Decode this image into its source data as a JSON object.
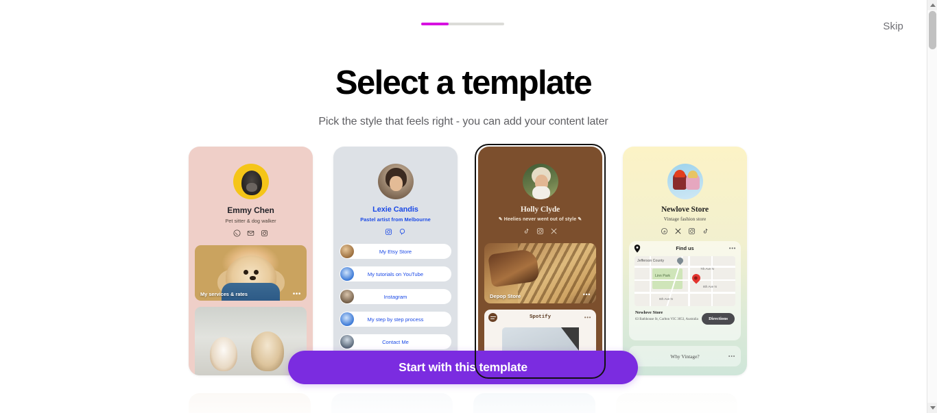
{
  "window": {
    "scrollbar": {
      "up_arrow": "▲",
      "down_arrow": "▼"
    }
  },
  "header": {
    "skip_label": "Skip",
    "progress": {
      "value": 33,
      "fill_color": "#d711e0",
      "track_color": "#dcdcd8"
    }
  },
  "page": {
    "title": "Select a template",
    "subtitle": "Pick the style that feels right - you can add your content later"
  },
  "cta": {
    "label": "Start with this template",
    "color": "#7b2ce0"
  },
  "templates": [
    {
      "id": "emmy-chen",
      "selected": false,
      "background": "#efcfc8",
      "profile": {
        "name": "Emmy Chen",
        "tagline": "Pet sitter & dog walker",
        "socials": [
          "whatsapp-icon",
          "mail-icon",
          "instagram-icon"
        ]
      },
      "blocks": [
        {
          "type": "image-card",
          "caption": "My services & rates",
          "menu": "•••"
        },
        {
          "type": "image-card",
          "caption": "",
          "menu": ""
        }
      ]
    },
    {
      "id": "lexie-candis",
      "selected": false,
      "background": "#dde1e6",
      "profile": {
        "name": "Lexie Candis",
        "tagline": "Pastel artist from Melbourne",
        "socials": [
          "instagram-icon",
          "pinterest-icon"
        ]
      },
      "links": [
        "My Etsy Store",
        "My tutorials on YouTube",
        "Instagram",
        "My step by step process",
        "Contact Me"
      ]
    },
    {
      "id": "holly-clyde",
      "selected": true,
      "background": "#7c4f2d",
      "profile": {
        "name": "Holly Clyde",
        "tagline": "✎ Heelies never went out of style ✎",
        "socials": [
          "tiktok-icon",
          "instagram-icon",
          "x-icon"
        ]
      },
      "blocks": [
        {
          "type": "image-card",
          "caption": "Depop Store",
          "menu": "•••"
        },
        {
          "type": "spotify-embed",
          "title": "Spotify",
          "menu": "•••"
        }
      ]
    },
    {
      "id": "newlove-store",
      "selected": false,
      "background": "linear-gradient cream to mint",
      "profile": {
        "name": "Newlove Store",
        "tagline": "Vintage fashion store",
        "socials": [
          "threads-icon",
          "x-icon",
          "instagram-icon",
          "tiktok-icon"
        ]
      },
      "map_block": {
        "header": "Find us",
        "menu": "•••",
        "store_name": "Newlove Store",
        "address": "63 Bathhouse St, Carlton VIC 3053, Australia",
        "directions_label": "Directions",
        "map_labels": [
          "Jefferson County",
          "Linn Park",
          "7th Ave N",
          "8th Ave N",
          "6th Ave N"
        ]
      },
      "blocks": [
        {
          "type": "link-card",
          "caption": "Why Vintage?",
          "menu": "•••"
        }
      ]
    }
  ]
}
